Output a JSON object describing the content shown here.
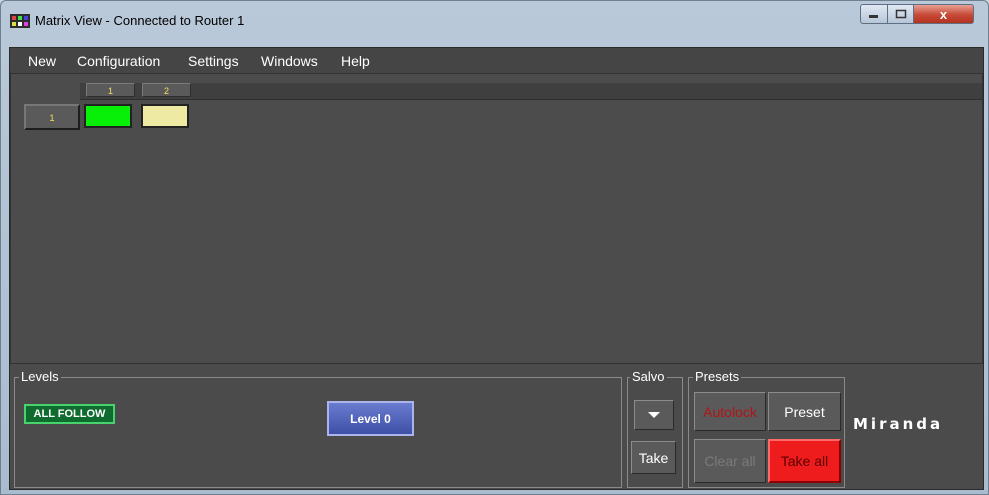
{
  "window": {
    "title": "Matrix View - Connected to Router 1",
    "close_glyph": "x",
    "app_icon": "grid-icon"
  },
  "menu": {
    "items": [
      {
        "label": "New"
      },
      {
        "label": "Configuration"
      },
      {
        "label": "Settings"
      },
      {
        "label": "Windows"
      },
      {
        "label": "Help"
      }
    ]
  },
  "matrix": {
    "destinations": [
      "1",
      "2"
    ],
    "sources": [
      "1"
    ],
    "cells": [
      {
        "state": "active",
        "color": "#08f008"
      },
      {
        "state": "inactive",
        "color": "#eee9a3"
      }
    ]
  },
  "levels": {
    "title": "Levels",
    "all_follow": "ALL FOLLOW",
    "level0": "Level 0"
  },
  "salvo": {
    "title": "Salvo",
    "take": "Take"
  },
  "presets": {
    "title": "Presets",
    "autolock": "Autolock",
    "preset": "Preset",
    "clear_all": "Clear all",
    "take_all": "Take all"
  },
  "brand": {
    "logo": "Miranda"
  },
  "colors": {
    "active_crosspoint": "#08f008",
    "take_all": "#ee1c1c",
    "level_button": "#4c5fb6",
    "all_follow": "#0f6b2e"
  }
}
